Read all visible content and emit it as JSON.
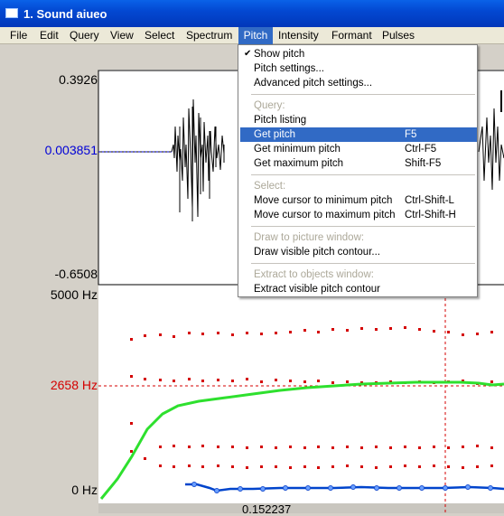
{
  "window": {
    "title": "1. Sound aiueo"
  },
  "menubar": [
    "File",
    "Edit",
    "Query",
    "View",
    "Select",
    "Spectrum",
    "Pitch",
    "Intensity",
    "Formant",
    "Pulses"
  ],
  "waveform": {
    "ymax": "0.3926",
    "ycursor": "0.003851",
    "ymin": "-0.6508"
  },
  "spectrogram": {
    "ymax": "5000 Hz",
    "ycursor": "2658 Hz",
    "ymin": "0 Hz",
    "xcursor": "0.152237"
  },
  "pitch_menu": {
    "show_pitch": "Show pitch",
    "pitch_settings": "Pitch settings...",
    "advanced_settings": "Advanced pitch settings...",
    "query_header": "Query:",
    "pitch_listing": "Pitch listing",
    "get_pitch": "Get pitch",
    "get_pitch_key": "F5",
    "get_min_pitch": "Get minimum pitch",
    "get_min_pitch_key": "Ctrl-F5",
    "get_max_pitch": "Get maximum pitch",
    "get_max_pitch_key": "Shift-F5",
    "select_header": "Select:",
    "move_min": "Move cursor to minimum pitch",
    "move_min_key": "Ctrl-Shift-L",
    "move_max": "Move cursor to maximum pitch",
    "move_max_key": "Ctrl-Shift-H",
    "draw_header": "Draw to picture window:",
    "draw_contour": "Draw visible pitch contour...",
    "extract_header": "Extract to objects window:",
    "extract_contour": "Extract visible pitch contour"
  },
  "colors": {
    "pitch": "#00e000",
    "formant": "#e00000",
    "intensity": "#0044cc",
    "cursor_label": "#0000d6",
    "hz_cursor": "#d40000"
  }
}
